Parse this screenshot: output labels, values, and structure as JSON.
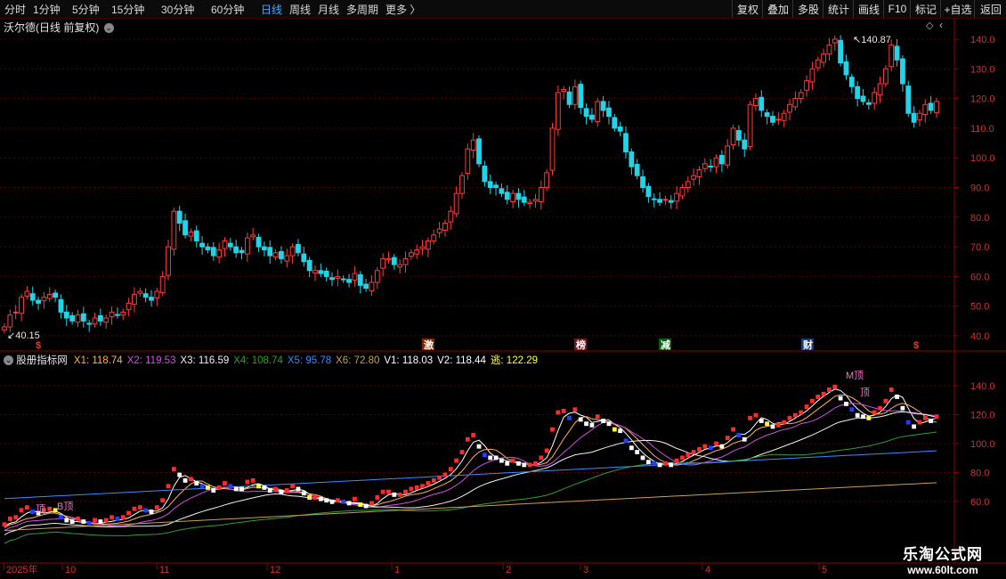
{
  "toolbar": {
    "left": [
      "分时",
      "1分钟",
      "5分钟",
      "15分钟",
      "30分钟",
      "60分钟",
      "日线",
      "周线",
      "月线",
      "多周期",
      "更多 〉"
    ],
    "active": "日线",
    "right": [
      "复权",
      "叠加",
      "多股",
      "统计",
      "画线",
      "F10",
      "标记",
      "+自选",
      "返回"
    ]
  },
  "main_chart": {
    "title": "沃尔德(日线 前复权)",
    "high_label": "140.87",
    "low_label": "40.15",
    "y_ticks": [
      "140.0",
      "130.0",
      "120.0",
      "110.0",
      "100.0",
      "90.0",
      "80.0",
      "70.0",
      "60.0",
      "50.0",
      "40.0"
    ],
    "markers": [
      {
        "text": "$",
        "color": "#ff3030"
      },
      {
        "text": "激",
        "color": "#ffffff"
      },
      {
        "text": "榜",
        "color": "#ffffff"
      },
      {
        "text": "减",
        "color": "#ffffff"
      },
      {
        "text": "财",
        "color": "#ffffff"
      },
      {
        "text": "$",
        "color": "#ff3030"
      }
    ]
  },
  "indicator": {
    "name": "股册指标网",
    "values": [
      {
        "label": "X1:",
        "value": "118.74",
        "color": "#ffb060"
      },
      {
        "label": "X2:",
        "value": "119.53",
        "color": "#d050e0"
      },
      {
        "label": "X3:",
        "value": "116.59",
        "color": "#f0f0f0"
      },
      {
        "label": "X4:",
        "value": "108.74",
        "color": "#2ea02e"
      },
      {
        "label": "X5:",
        "value": "95.78",
        "color": "#3a8cff"
      },
      {
        "label": "X6:",
        "value": "72.80",
        "color": "#c8a050"
      },
      {
        "label": "V1:",
        "value": "118.03",
        "color": "#ffffff"
      },
      {
        "label": "V2:",
        "value": "118.44",
        "color": "#ffffff"
      },
      {
        "label": "逃:",
        "value": "122.29",
        "color": "#ffff40"
      }
    ],
    "y_ticks": [
      "140.0",
      "120.0",
      "100.0",
      "80.0",
      "60.0"
    ],
    "signals": [
      "顶",
      "B顶",
      "M顶",
      "顶"
    ]
  },
  "time_axis": [
    "2025年",
    "10",
    "11",
    "12",
    "1",
    "2",
    "3",
    "4",
    "5"
  ],
  "watermark": {
    "line1": "乐淘公式网",
    "line2": "www.60lt.com"
  },
  "price_series": [
    43,
    47,
    48,
    53,
    55,
    52,
    51,
    53,
    54,
    53,
    48,
    46,
    45,
    47,
    45,
    44,
    46,
    45,
    46,
    48,
    47,
    48,
    51,
    54,
    55,
    53,
    52,
    55,
    60,
    70,
    82,
    78,
    74,
    75,
    72,
    70,
    69,
    67,
    69,
    72,
    70,
    68,
    68,
    73,
    74,
    70,
    69,
    67,
    68,
    66,
    67,
    70,
    68,
    65,
    62,
    62,
    61,
    60,
    59,
    60,
    59,
    58,
    61,
    57,
    56,
    58,
    62,
    66,
    66,
    64,
    64,
    66,
    68,
    69,
    70,
    72,
    74,
    76,
    78,
    82,
    88,
    94,
    103,
    106,
    98,
    92,
    90,
    90,
    88,
    86,
    88,
    86,
    85,
    85,
    86,
    90,
    95,
    110,
    122,
    123,
    118,
    124,
    117,
    114,
    113,
    119,
    116,
    114,
    110,
    109,
    102,
    97,
    94,
    90,
    87,
    86,
    85,
    86,
    85,
    88,
    90,
    92,
    94,
    96,
    98,
    97,
    100,
    98,
    104,
    110,
    106,
    103,
    118,
    120,
    116,
    114,
    112,
    113,
    115,
    118,
    120,
    122,
    126,
    130,
    133,
    135,
    138,
    140,
    132,
    128,
    124,
    120,
    119,
    118,
    122,
    125,
    130,
    138,
    133,
    125,
    115,
    112,
    115,
    118,
    116,
    119
  ]
}
